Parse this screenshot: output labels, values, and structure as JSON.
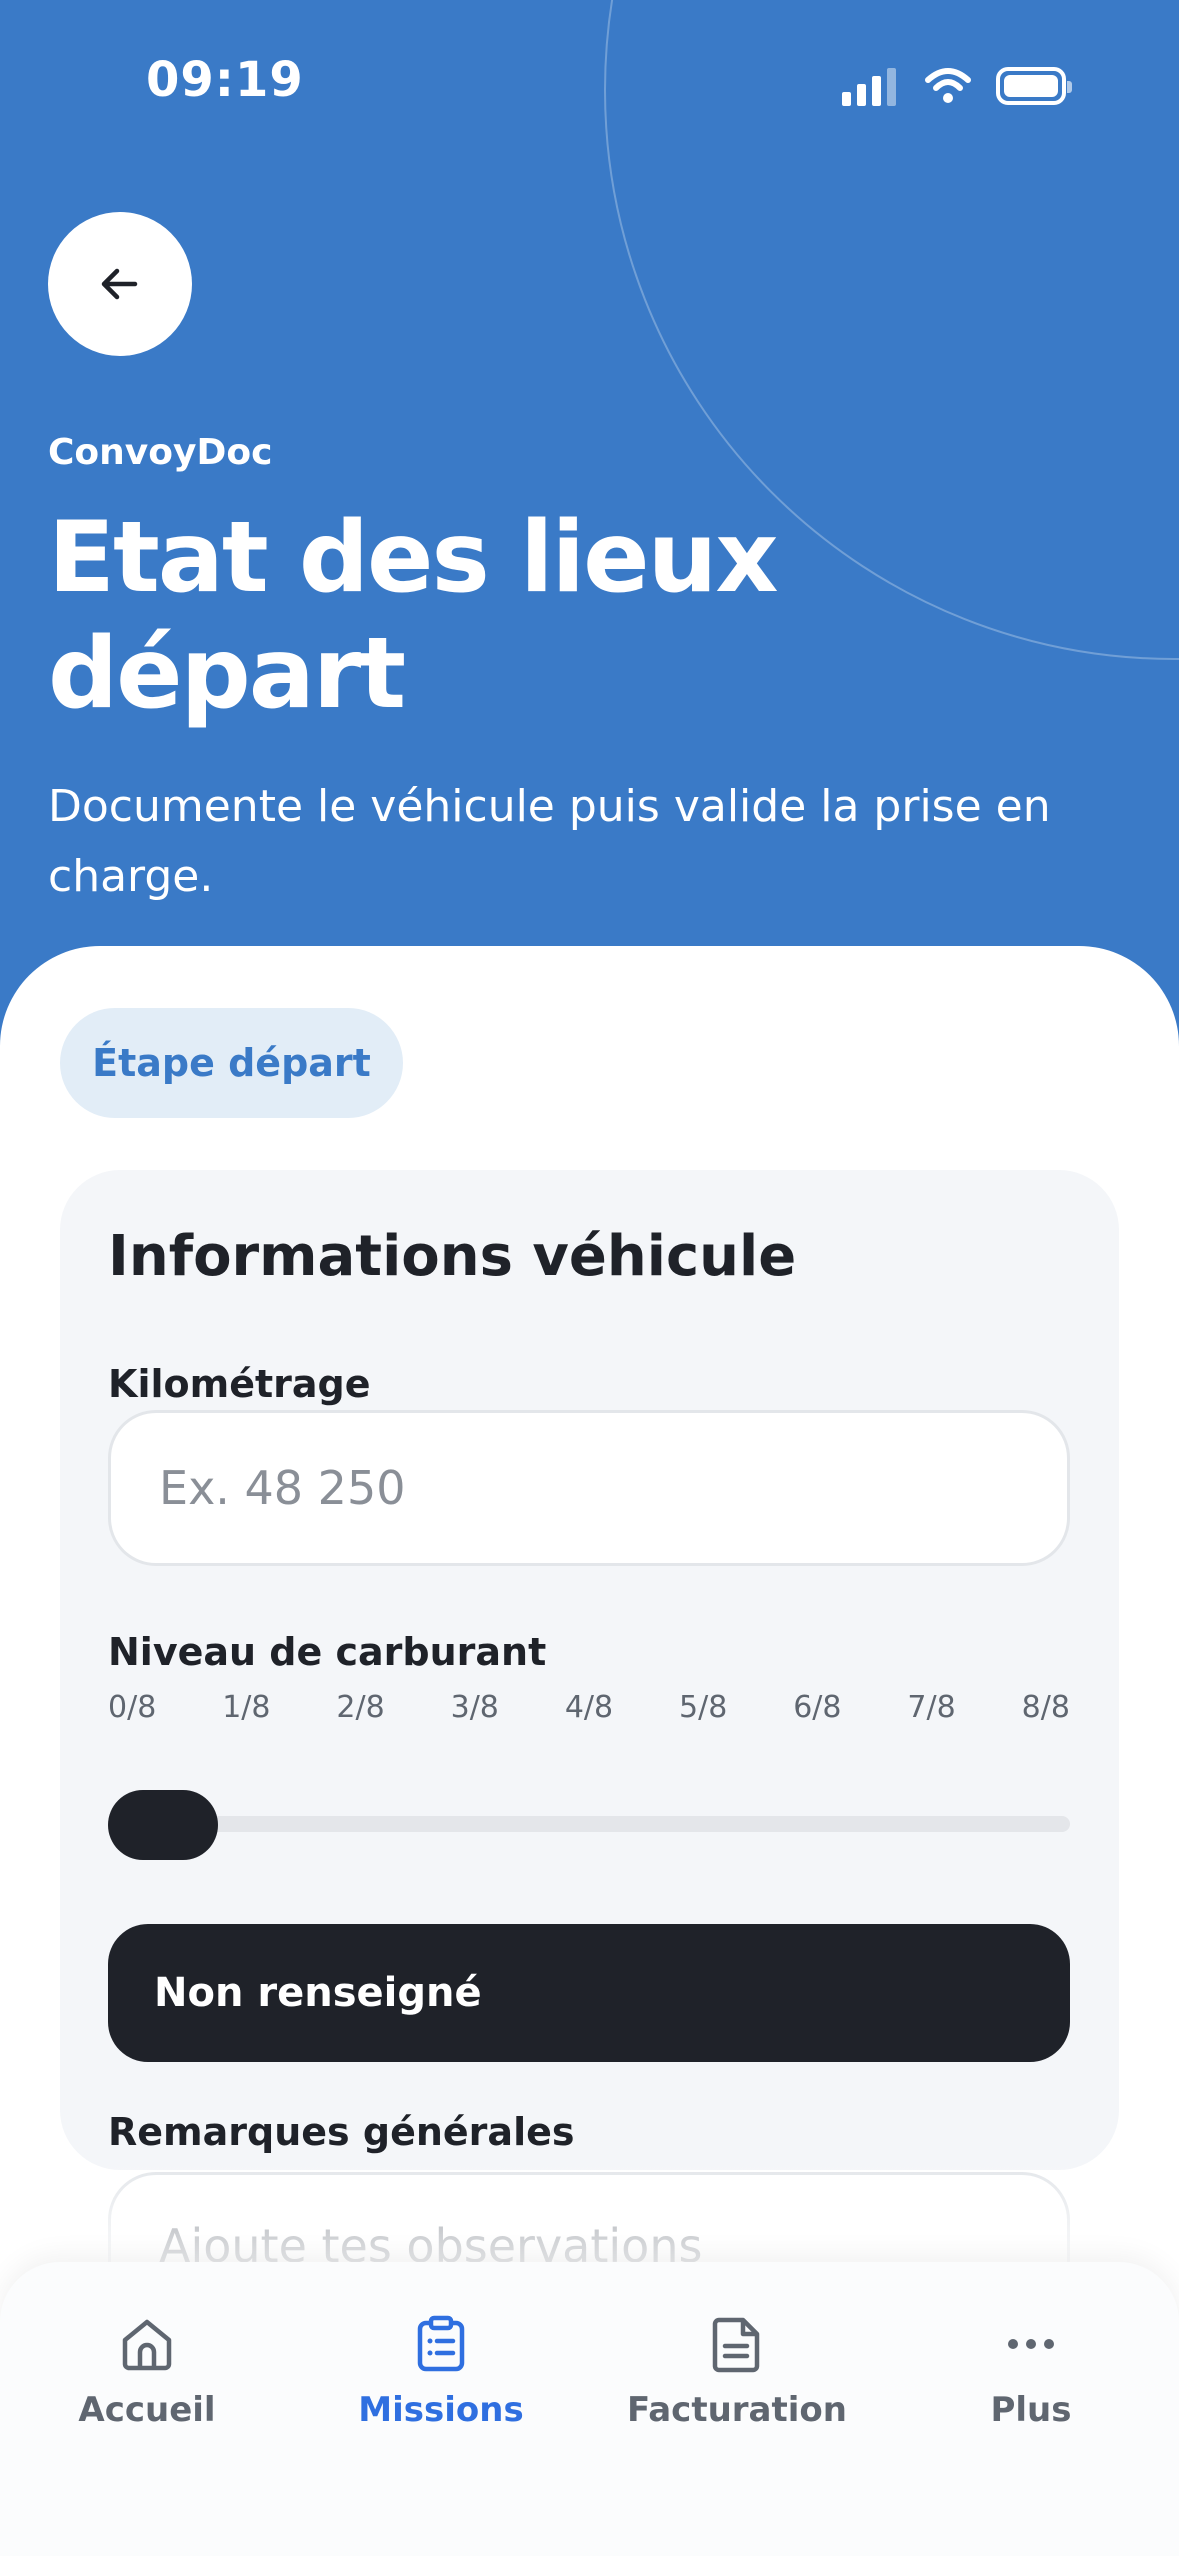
{
  "status_bar": {
    "time": "09:19"
  },
  "header": {
    "app_name": "ConvoyDoc",
    "title": "Etat des lieux départ",
    "subtitle": "Documente le véhicule puis valide la prise en charge."
  },
  "step_badge": "Étape départ",
  "vehicle_card": {
    "title": "Informations véhicule",
    "mileage": {
      "label": "Kilométrage",
      "placeholder": "Ex. 48 250",
      "value": ""
    },
    "fuel": {
      "label": "Niveau de carburant",
      "ticks": [
        "0/8",
        "1/8",
        "2/8",
        "3/8",
        "4/8",
        "5/8",
        "6/8",
        "7/8",
        "8/8"
      ],
      "level_eighths": 0,
      "status": "Non renseigné"
    },
    "remarks": {
      "label": "Remarques générales",
      "placeholder": "Ajoute tes observations",
      "value": ""
    }
  },
  "tab_bar": {
    "items": [
      {
        "label": "Accueil",
        "icon": "home-icon",
        "active": false
      },
      {
        "label": "Missions",
        "icon": "clipboard-list-icon",
        "active": true
      },
      {
        "label": "Facturation",
        "icon": "document-icon",
        "active": false
      },
      {
        "label": "Plus",
        "icon": "more-dots-icon",
        "active": false
      }
    ]
  },
  "colors": {
    "header_blue": "#3a7ac7",
    "active_tab": "#2f6fe0",
    "dark": "#1f2229",
    "badge_bg": "#e2edf7",
    "card_bg": "#f4f6f9"
  }
}
